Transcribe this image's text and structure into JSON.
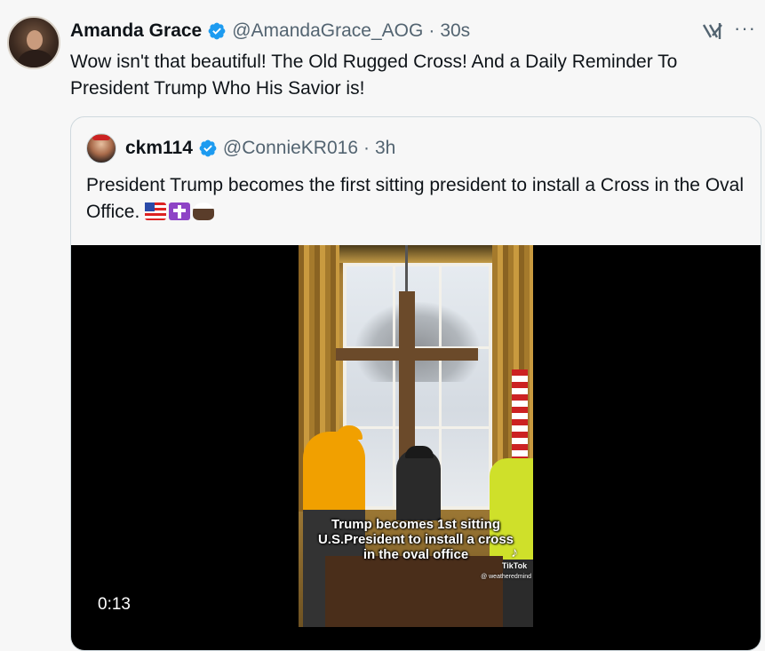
{
  "tweet": {
    "display_name": "Amanda Grace",
    "handle": "@AmandaGrace_AOG",
    "separator": "·",
    "time": "30s",
    "text": "Wow isn't that beautiful! The Old Rugged Cross! And a Daily Reminder To President Trump Who His Savior is!",
    "verified_icon": "verified-badge-icon",
    "grok_icon": "grok-icon",
    "more_icon": "more-options-icon"
  },
  "quote": {
    "display_name": "ckm114",
    "handle": "@ConnieKR016",
    "separator": "·",
    "time": "3h",
    "text": "President Trump becomes the first sitting president to install a Cross in the Oval Office.",
    "emojis": [
      "us-flag-emoji",
      "latin-cross-emoji",
      "eagle-emoji"
    ],
    "video": {
      "caption": "Trump becomes 1st sitting U.S.President to install a cross in the oval office",
      "tiktok_label": "TikTok",
      "tiktok_credit": "@ weatheredmind",
      "duration": "0:13"
    }
  },
  "colors": {
    "background": "#f7f7f7",
    "text_primary": "#0f1419",
    "text_secondary": "#536471",
    "verified_blue": "#1d9bf0",
    "border": "#cfd9de"
  }
}
